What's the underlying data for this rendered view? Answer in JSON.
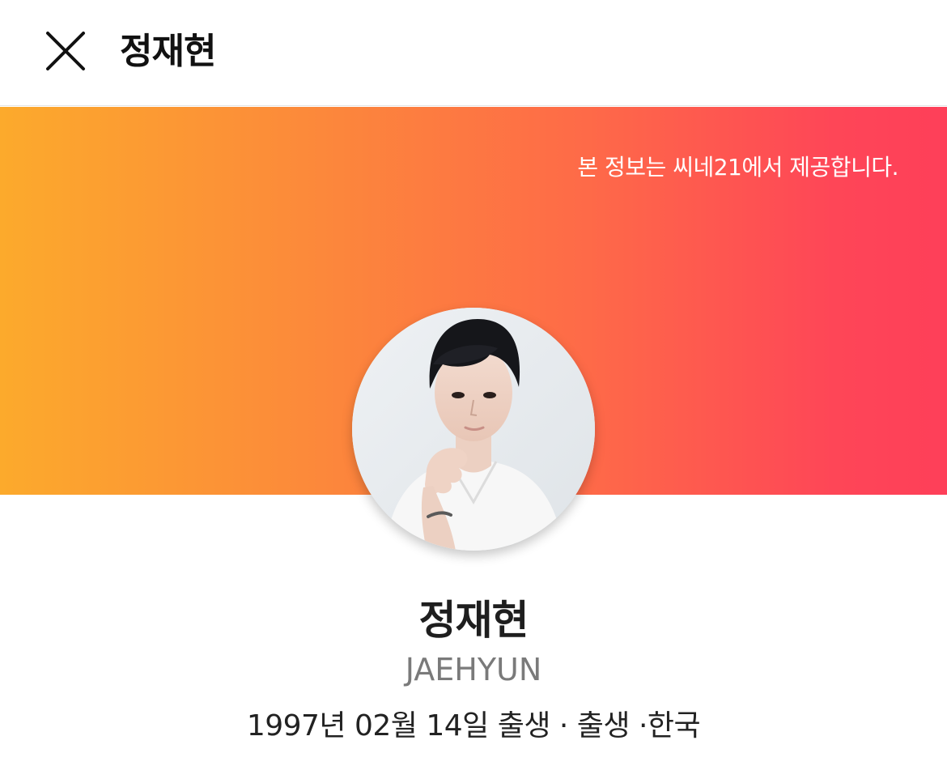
{
  "header": {
    "title": "정재현",
    "close_icon": "close-x-icon"
  },
  "banner": {
    "source_text": "본 정보는 씨네21에서 제공합니다.",
    "gradient_colors": [
      "#fcaa2c",
      "#fc8a3a",
      "#fe6a48",
      "#fe4657",
      "#fe3f59"
    ]
  },
  "profile": {
    "photo": "profile-photo",
    "name": "정재현",
    "english_name": "JAEHYUN",
    "meta": "1997년 02월 14일 출생 · 출생 ·한국"
  }
}
